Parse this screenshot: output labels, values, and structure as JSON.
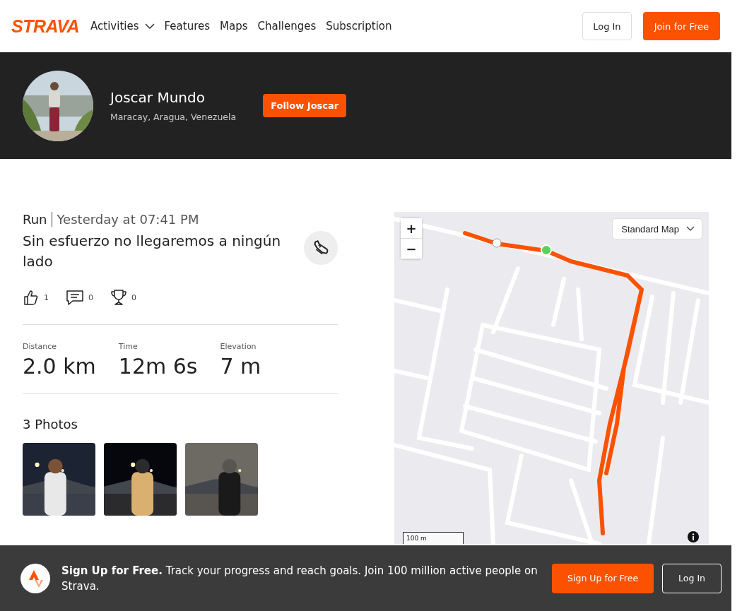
{
  "header": {
    "logo": "STRAVA",
    "nav": [
      {
        "label": "Activities",
        "dropdown": true
      },
      {
        "label": "Features",
        "dropdown": false
      },
      {
        "label": "Maps",
        "dropdown": false
      },
      {
        "label": "Challenges",
        "dropdown": false
      },
      {
        "label": "Subscription",
        "dropdown": false
      }
    ],
    "login": "Log In",
    "join": "Join for Free"
  },
  "profile": {
    "name": "Joscar Mundo",
    "location": "Maracay, Aragua, Venezuela",
    "follow": "Follow Joscar"
  },
  "activity": {
    "type": "Run",
    "time": "Yesterday at 07:41 PM",
    "title": "Sin esfuerzo no llegaremos a ningún lado",
    "kudos": "1",
    "comments": "0",
    "achievements": "0",
    "stats": [
      {
        "label": "Distance",
        "value": "2.0 km"
      },
      {
        "label": "Time",
        "value": "12m 6s"
      },
      {
        "label": "Elevation",
        "value": "7 m"
      }
    ],
    "photos_title": "3 Photos"
  },
  "map": {
    "style": "Standard Map",
    "zoom_in": "+",
    "zoom_out": "−",
    "scale": "100 m"
  },
  "banner": {
    "text": "**Sign Up for Free.** Track your progress and reach goals. Join 100 million active people on Strava.",
    "signup": "Sign Up for Free",
    "login": "Log In"
  }
}
